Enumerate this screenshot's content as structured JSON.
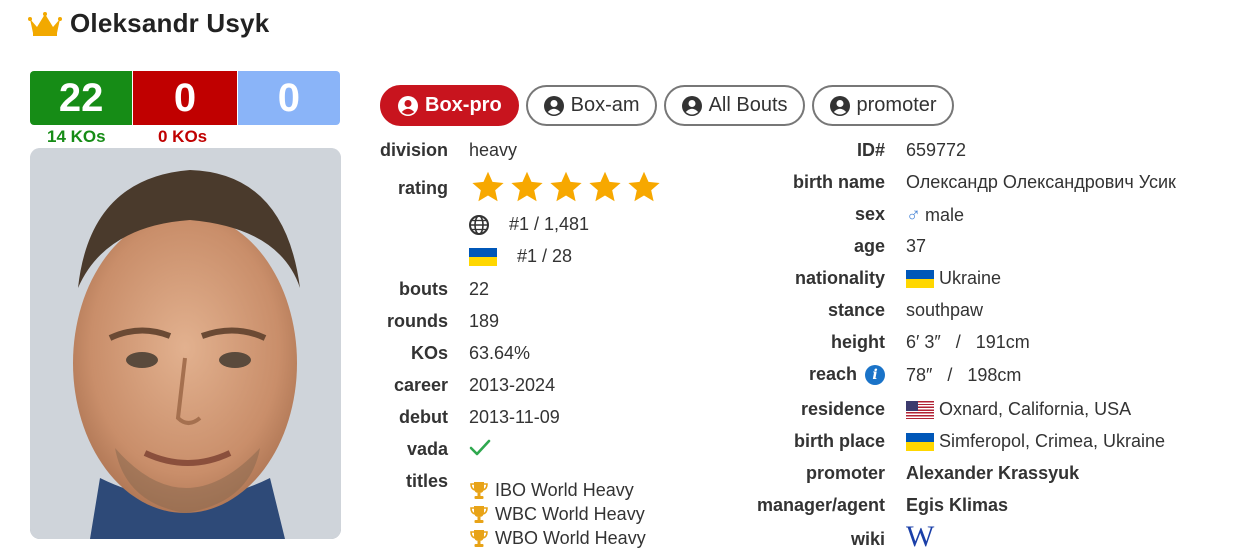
{
  "header": {
    "name": "Oleksandr Usyk",
    "icon": "crown-icon"
  },
  "record": {
    "wins": "22",
    "losses": "0",
    "draws": "0",
    "win_kos": "14 KOs",
    "loss_kos": "0 KOs",
    "colors": {
      "win": "#168c16",
      "loss": "#c00000",
      "draw": "#8ab4f8"
    }
  },
  "tabs": [
    {
      "label": "Box-pro",
      "active": true
    },
    {
      "label": "Box-am",
      "active": false
    },
    {
      "label": "All Bouts",
      "active": false
    },
    {
      "label": "promoter",
      "active": false
    }
  ],
  "left": {
    "division": {
      "label": "division",
      "value": "heavy"
    },
    "rating": {
      "label": "rating",
      "stars": 5,
      "max_stars": 5,
      "world_rank": "#1 / 1,481",
      "country_rank": "#1 / 28"
    },
    "bouts": {
      "label": "bouts",
      "value": "22"
    },
    "rounds": {
      "label": "rounds",
      "value": "189"
    },
    "kos": {
      "label": "KOs",
      "value": "63.64%"
    },
    "career": {
      "label": "career",
      "value": "2013-2024"
    },
    "debut": {
      "label": "debut",
      "value": "2013-11-09"
    },
    "vada": {
      "label": "vada",
      "value": "check-icon"
    },
    "titles": {
      "label": "titles",
      "items": [
        "IBO World Heavy",
        "WBC World Heavy",
        "WBO World Heavy"
      ]
    }
  },
  "right": {
    "id": {
      "label": "ID#",
      "value": "659772"
    },
    "birth_name": {
      "label": "birth name",
      "value": "Олександр Олександрович Усик"
    },
    "sex": {
      "label": "sex",
      "value": "male",
      "icon": "♂"
    },
    "age": {
      "label": "age",
      "value": "37"
    },
    "nationality": {
      "label": "nationality",
      "value": "Ukraine"
    },
    "stance": {
      "label": "stance",
      "value": "southpaw"
    },
    "height": {
      "label": "height",
      "value": "6′ 3″   /   191cm"
    },
    "reach": {
      "label": "reach",
      "value": "78″   /   198cm",
      "info": "i"
    },
    "residence": {
      "label": "residence",
      "value": "Oxnard, California, USA"
    },
    "birth_place": {
      "label": "birth place",
      "value": "Simferopol, Crimea, Ukraine"
    },
    "promoter": {
      "label": "promoter",
      "value": "Alexander Krassyuk"
    },
    "manager": {
      "label": "manager/agent",
      "value": "Egis Klimas"
    },
    "wiki": {
      "label": "wiki",
      "value": "W"
    }
  }
}
